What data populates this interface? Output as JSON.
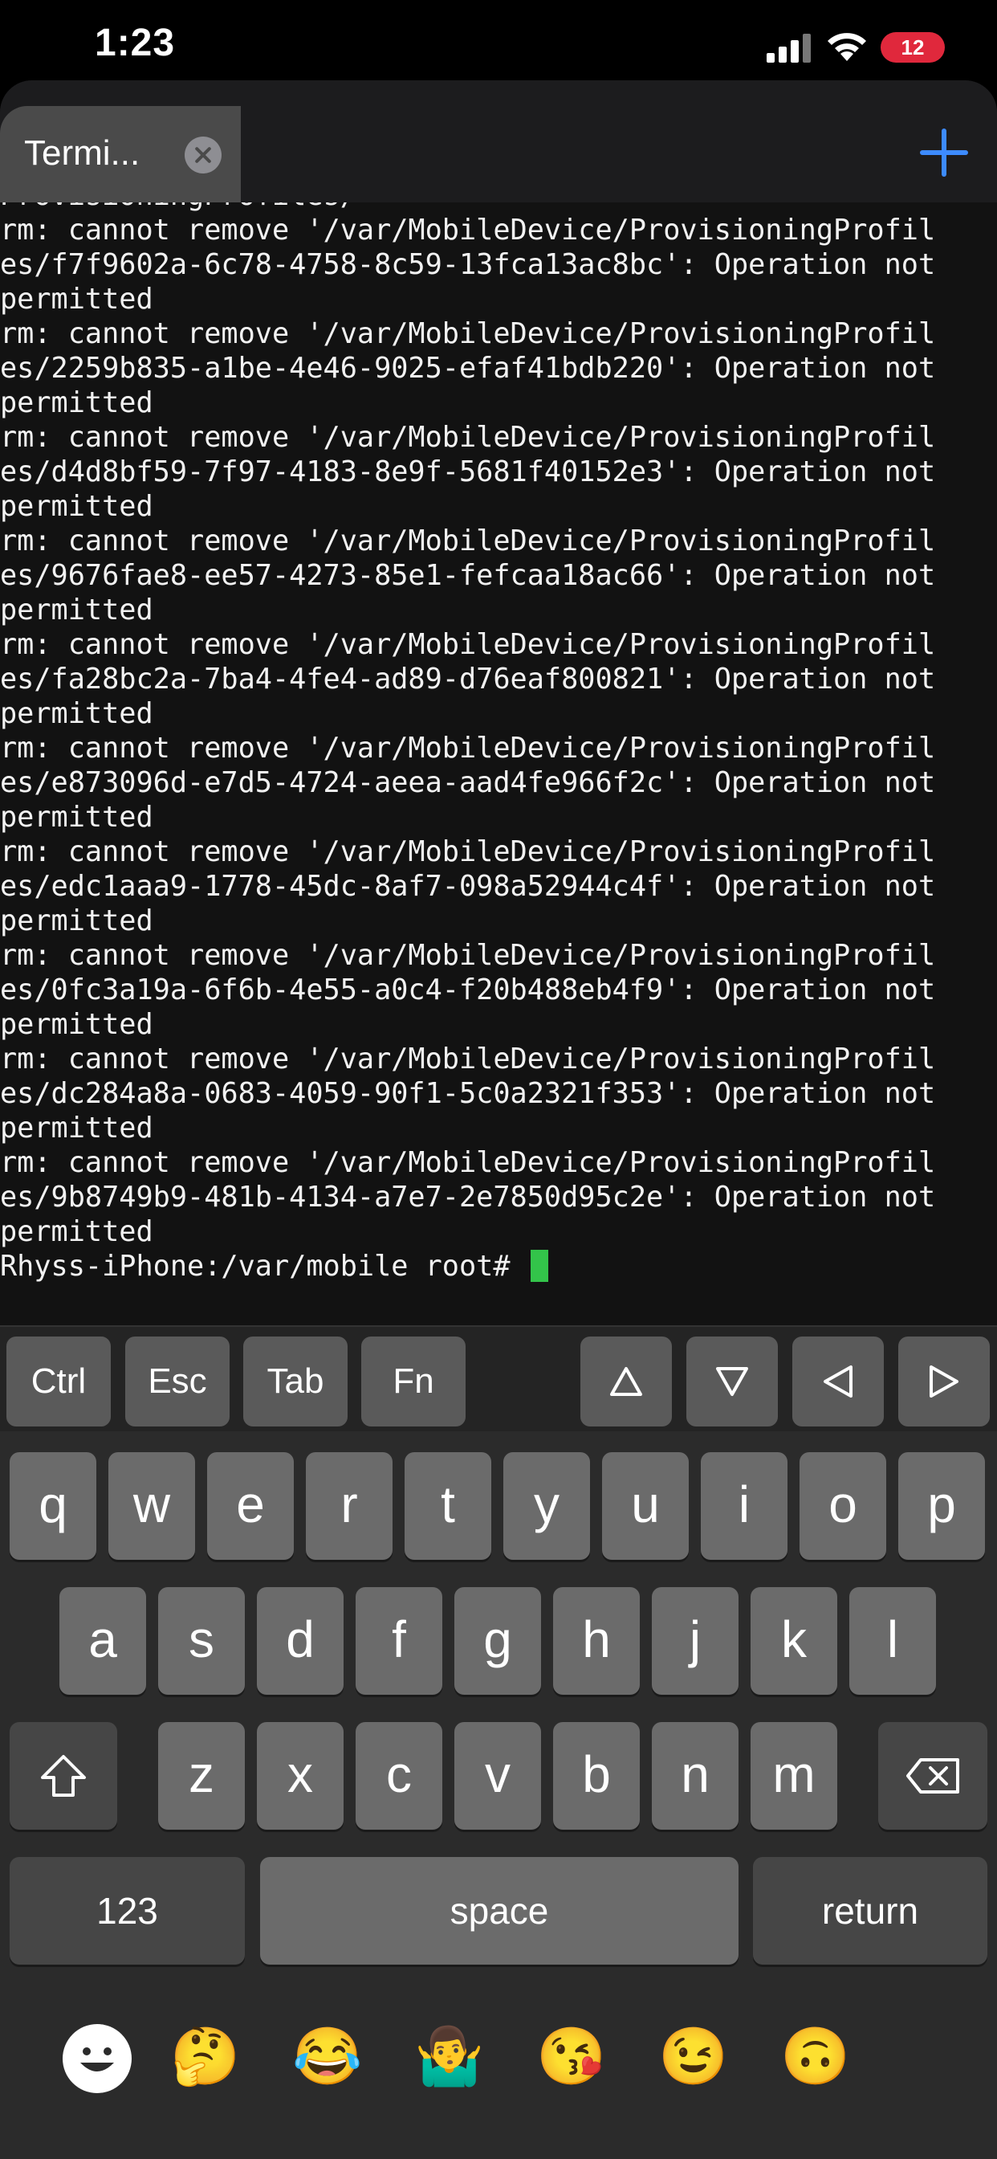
{
  "status_bar": {
    "time": "1:23",
    "battery": "12"
  },
  "tab": {
    "title": "Termi..."
  },
  "terminal": {
    "lines": [
      "ProvisioningProfiles/",
      "rm: cannot remove '/var/MobileDevice/ProvisioningProfil",
      "es/f7f9602a-6c78-4758-8c59-13fca13ac8bc': Operation not",
      "permitted",
      "rm: cannot remove '/var/MobileDevice/ProvisioningProfil",
      "es/2259b835-a1be-4e46-9025-efaf41bdb220': Operation not",
      "permitted",
      "rm: cannot remove '/var/MobileDevice/ProvisioningProfil",
      "es/d4d8bf59-7f97-4183-8e9f-5681f40152e3': Operation not",
      "permitted",
      "rm: cannot remove '/var/MobileDevice/ProvisioningProfil",
      "es/9676fae8-ee57-4273-85e1-fefcaa18ac66': Operation not",
      "permitted",
      "rm: cannot remove '/var/MobileDevice/ProvisioningProfil",
      "es/fa28bc2a-7ba4-4fe4-ad89-d76eaf800821': Operation not",
      "permitted",
      "rm: cannot remove '/var/MobileDevice/ProvisioningProfil",
      "es/e873096d-e7d5-4724-aeea-aad4fe966f2c': Operation not",
      "permitted",
      "rm: cannot remove '/var/MobileDevice/ProvisioningProfil",
      "es/edc1aaa9-1778-45dc-8af7-098a52944c4f': Operation not",
      "permitted",
      "rm: cannot remove '/var/MobileDevice/ProvisioningProfil",
      "es/0fc3a19a-6f6b-4e55-a0c4-f20b488eb4f9': Operation not",
      "permitted",
      "rm: cannot remove '/var/MobileDevice/ProvisioningProfil",
      "es/dc284a8a-0683-4059-90f1-5c0a2321f353': Operation not",
      "permitted",
      "rm: cannot remove '/var/MobileDevice/ProvisioningProfil",
      "es/9b8749b9-481b-4134-a7e7-2e7850d95c2e': Operation not",
      "permitted"
    ],
    "prompt": "Rhyss-iPhone:/var/mobile root# ",
    "cursor_color": "#33c44a"
  },
  "accessory_bar": {
    "ctrl": "Ctrl",
    "esc": "Esc",
    "tab": "Tab",
    "fn": "Fn"
  },
  "keyboard": {
    "row1": [
      "q",
      "w",
      "e",
      "r",
      "t",
      "y",
      "u",
      "i",
      "o",
      "p"
    ],
    "row2": [
      "a",
      "s",
      "d",
      "f",
      "g",
      "h",
      "j",
      "k",
      "l"
    ],
    "row3": [
      "z",
      "x",
      "c",
      "v",
      "b",
      "n",
      "m"
    ],
    "numbers_label": "123",
    "space_label": "space",
    "return_label": "return"
  },
  "emoji_bar": [
    "🤔",
    "😂",
    "🤷‍♂️",
    "😘",
    "😉",
    "🙃"
  ],
  "colors": {
    "accent": "#3d8bff",
    "battery": "#e0283c"
  }
}
